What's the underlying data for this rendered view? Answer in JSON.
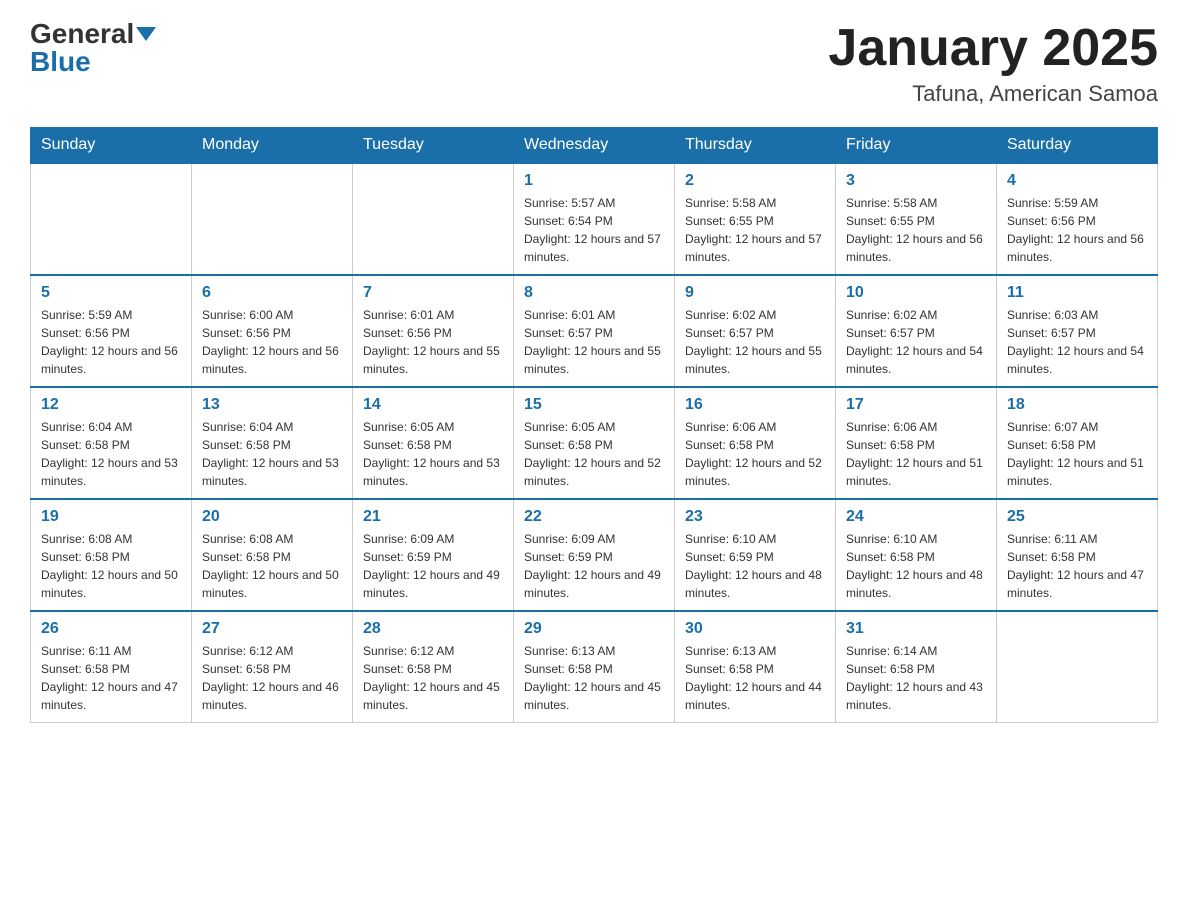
{
  "header": {
    "logo_general": "General",
    "logo_blue": "Blue",
    "month_title": "January 2025",
    "location": "Tafuna, American Samoa"
  },
  "days_of_week": [
    "Sunday",
    "Monday",
    "Tuesday",
    "Wednesday",
    "Thursday",
    "Friday",
    "Saturday"
  ],
  "weeks": [
    [
      {
        "day": "",
        "info": ""
      },
      {
        "day": "",
        "info": ""
      },
      {
        "day": "",
        "info": ""
      },
      {
        "day": "1",
        "info": "Sunrise: 5:57 AM\nSunset: 6:54 PM\nDaylight: 12 hours and 57 minutes."
      },
      {
        "day": "2",
        "info": "Sunrise: 5:58 AM\nSunset: 6:55 PM\nDaylight: 12 hours and 57 minutes."
      },
      {
        "day": "3",
        "info": "Sunrise: 5:58 AM\nSunset: 6:55 PM\nDaylight: 12 hours and 56 minutes."
      },
      {
        "day": "4",
        "info": "Sunrise: 5:59 AM\nSunset: 6:56 PM\nDaylight: 12 hours and 56 minutes."
      }
    ],
    [
      {
        "day": "5",
        "info": "Sunrise: 5:59 AM\nSunset: 6:56 PM\nDaylight: 12 hours and 56 minutes."
      },
      {
        "day": "6",
        "info": "Sunrise: 6:00 AM\nSunset: 6:56 PM\nDaylight: 12 hours and 56 minutes."
      },
      {
        "day": "7",
        "info": "Sunrise: 6:01 AM\nSunset: 6:56 PM\nDaylight: 12 hours and 55 minutes."
      },
      {
        "day": "8",
        "info": "Sunrise: 6:01 AM\nSunset: 6:57 PM\nDaylight: 12 hours and 55 minutes."
      },
      {
        "day": "9",
        "info": "Sunrise: 6:02 AM\nSunset: 6:57 PM\nDaylight: 12 hours and 55 minutes."
      },
      {
        "day": "10",
        "info": "Sunrise: 6:02 AM\nSunset: 6:57 PM\nDaylight: 12 hours and 54 minutes."
      },
      {
        "day": "11",
        "info": "Sunrise: 6:03 AM\nSunset: 6:57 PM\nDaylight: 12 hours and 54 minutes."
      }
    ],
    [
      {
        "day": "12",
        "info": "Sunrise: 6:04 AM\nSunset: 6:58 PM\nDaylight: 12 hours and 53 minutes."
      },
      {
        "day": "13",
        "info": "Sunrise: 6:04 AM\nSunset: 6:58 PM\nDaylight: 12 hours and 53 minutes."
      },
      {
        "day": "14",
        "info": "Sunrise: 6:05 AM\nSunset: 6:58 PM\nDaylight: 12 hours and 53 minutes."
      },
      {
        "day": "15",
        "info": "Sunrise: 6:05 AM\nSunset: 6:58 PM\nDaylight: 12 hours and 52 minutes."
      },
      {
        "day": "16",
        "info": "Sunrise: 6:06 AM\nSunset: 6:58 PM\nDaylight: 12 hours and 52 minutes."
      },
      {
        "day": "17",
        "info": "Sunrise: 6:06 AM\nSunset: 6:58 PM\nDaylight: 12 hours and 51 minutes."
      },
      {
        "day": "18",
        "info": "Sunrise: 6:07 AM\nSunset: 6:58 PM\nDaylight: 12 hours and 51 minutes."
      }
    ],
    [
      {
        "day": "19",
        "info": "Sunrise: 6:08 AM\nSunset: 6:58 PM\nDaylight: 12 hours and 50 minutes."
      },
      {
        "day": "20",
        "info": "Sunrise: 6:08 AM\nSunset: 6:58 PM\nDaylight: 12 hours and 50 minutes."
      },
      {
        "day": "21",
        "info": "Sunrise: 6:09 AM\nSunset: 6:59 PM\nDaylight: 12 hours and 49 minutes."
      },
      {
        "day": "22",
        "info": "Sunrise: 6:09 AM\nSunset: 6:59 PM\nDaylight: 12 hours and 49 minutes."
      },
      {
        "day": "23",
        "info": "Sunrise: 6:10 AM\nSunset: 6:59 PM\nDaylight: 12 hours and 48 minutes."
      },
      {
        "day": "24",
        "info": "Sunrise: 6:10 AM\nSunset: 6:58 PM\nDaylight: 12 hours and 48 minutes."
      },
      {
        "day": "25",
        "info": "Sunrise: 6:11 AM\nSunset: 6:58 PM\nDaylight: 12 hours and 47 minutes."
      }
    ],
    [
      {
        "day": "26",
        "info": "Sunrise: 6:11 AM\nSunset: 6:58 PM\nDaylight: 12 hours and 47 minutes."
      },
      {
        "day": "27",
        "info": "Sunrise: 6:12 AM\nSunset: 6:58 PM\nDaylight: 12 hours and 46 minutes."
      },
      {
        "day": "28",
        "info": "Sunrise: 6:12 AM\nSunset: 6:58 PM\nDaylight: 12 hours and 45 minutes."
      },
      {
        "day": "29",
        "info": "Sunrise: 6:13 AM\nSunset: 6:58 PM\nDaylight: 12 hours and 45 minutes."
      },
      {
        "day": "30",
        "info": "Sunrise: 6:13 AM\nSunset: 6:58 PM\nDaylight: 12 hours and 44 minutes."
      },
      {
        "day": "31",
        "info": "Sunrise: 6:14 AM\nSunset: 6:58 PM\nDaylight: 12 hours and 43 minutes."
      },
      {
        "day": "",
        "info": ""
      }
    ]
  ]
}
